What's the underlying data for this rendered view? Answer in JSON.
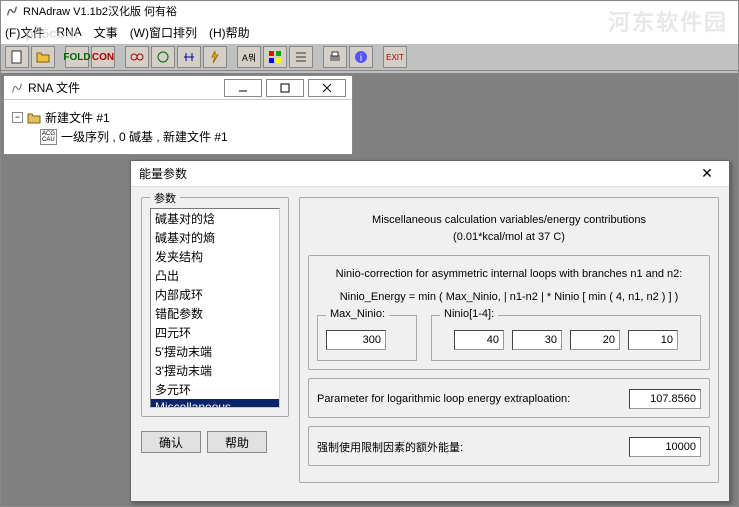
{
  "app": {
    "title": "RNAdraw V1.1b2汉化版 何有裕"
  },
  "watermark": {
    "main": "河东软件园",
    "sub": "p35com"
  },
  "menu": {
    "file": "(F)文件",
    "rna": "RNA",
    "docs": "文事",
    "window": "(W)窗口排列",
    "help": "(H)帮助"
  },
  "child": {
    "title": "RNA 文件",
    "root": "新建文件 #1",
    "item": "一级序列 , 0 碱基 , 新建文件 #1",
    "item_badge": "ACG\nCAU"
  },
  "dialog": {
    "title": "能量参数",
    "group_params": "参数",
    "params_list": [
      "碱基对的焓",
      "碱基对的熵",
      "发夹结构",
      "凸出",
      "内部成环",
      "错配参数",
      "四元环",
      "5'摆动末端",
      "3'摆动末端",
      "多元环",
      "Miscellaneous"
    ],
    "selected_index": 10,
    "ok": "确认",
    "help": "帮助",
    "right": {
      "heading1": "Miscellaneous calculation variables/energy contributions",
      "heading2": "(0.01*kcal/mol at 37 C)",
      "ninio_desc": "Ninio-correction for asymmetric internal loops with branches n1 and n2:",
      "ninio_formula": "Ninio_Energy = min ( Max_Ninio, | n1-n2 | * Ninio [ min ( 4, n1, n2 ) ] )",
      "max_ninio_label": "Max_Ninio:",
      "max_ninio_value": "300",
      "ninio_arr_label": "Ninio[1-4]:",
      "ninio_values": [
        "40",
        "30",
        "20",
        "10"
      ],
      "log_label": "Parameter for logarithmic loop energy extraploation:",
      "log_value": "107.8560",
      "force_label": "强制使用限制因素的额外能量:",
      "force_value": "10000"
    }
  }
}
